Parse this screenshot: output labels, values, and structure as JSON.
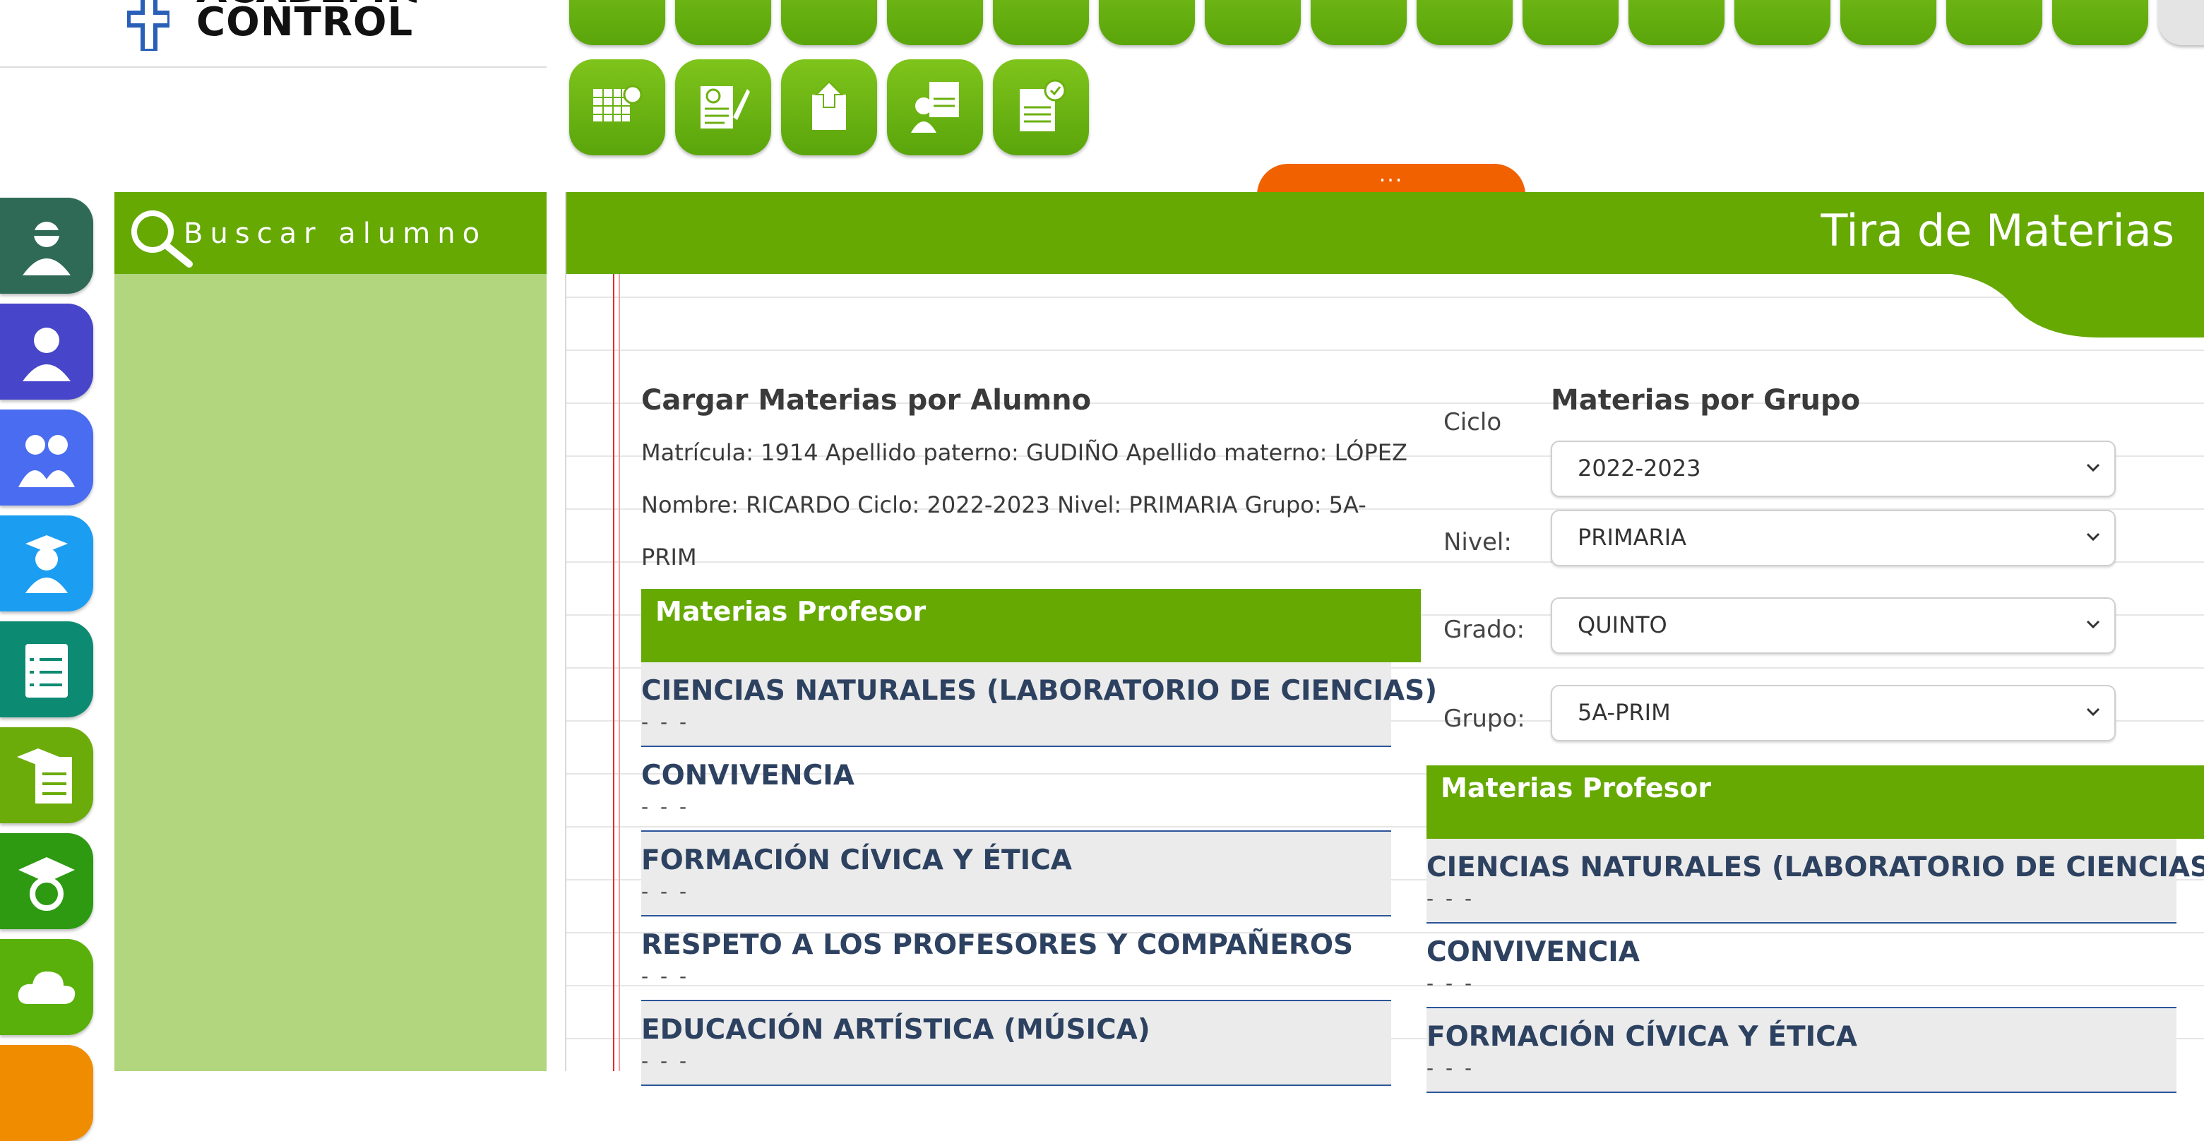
{
  "logo": {
    "brand": "CONTROL",
    "brand_top": "ACADEMIC"
  },
  "top_icons": [
    "checklist-icon",
    "chat-icon",
    "search-doc-icon",
    "student-search-icon",
    "sad-face-icon",
    "check-badge-icon",
    "percent-list-icon",
    "bar-chart-icon",
    "money-stack-icon",
    "task-list-icon",
    "graduate-icon",
    "bills-icon",
    "schedule-icon",
    "flow-lock-icon",
    "approve-list-icon",
    "calendar-grid-icon",
    "grade-edit-icon",
    "upload-doc-icon",
    "teacher-cert-icon",
    "certificate-icon"
  ],
  "expander": {
    "label": "..."
  },
  "side_icons": [
    {
      "name": "teacher-icon",
      "color": "#2e6a55"
    },
    {
      "name": "director-icon",
      "color": "#4745c9"
    },
    {
      "name": "parents-icon",
      "color": "#4a6cf0"
    },
    {
      "name": "student-icon",
      "color": "#1b9ef1"
    },
    {
      "name": "clipboard-icon",
      "color": "#0d8a72"
    },
    {
      "name": "courses-icon",
      "color": "#6cac0a"
    },
    {
      "name": "graduation-settings-icon",
      "color": "#2d9a12"
    },
    {
      "name": "cloud-icon",
      "color": "#5ab00a"
    },
    {
      "name": "extra-icon",
      "color": "#f08c00"
    }
  ],
  "search": {
    "label": "Buscar alumno"
  },
  "header": {
    "title": "Tira de Materias"
  },
  "student": {
    "heading": "Cargar Materias por Alumno",
    "line1": "Matrícula: 1914 Apellido paterno: GUDIÑO Apellido materno: LÓPEZ",
    "line2": "Nombre: RICARDO Ciclo: 2022-2023 Nivel: PRIMARIA Grupo: 5A-",
    "line3": "PRIM",
    "bar_label": "Materias Profesor",
    "subjects": [
      {
        "name": "CIENCIAS NATURALES (LABORATORIO DE CIENCIAS)",
        "dash": "- - -"
      },
      {
        "name": "CONVIVENCIA",
        "dash": "- - -"
      },
      {
        "name": "FORMACIÓN CÍVICA Y ÉTICA",
        "dash": "- - -"
      },
      {
        "name": "RESPETO A LOS PROFESORES Y COMPAÑEROS",
        "dash": "- - -"
      },
      {
        "name": "EDUCACIÓN ARTÍSTICA (MÚSICA)",
        "dash": "- - -"
      }
    ]
  },
  "group": {
    "heading": "Materias por Grupo",
    "ciclo_label": "Ciclo",
    "ciclo_value": "2022-2023",
    "nivel_label": "Nivel:",
    "nivel_value": "PRIMARIA",
    "grado_label": "Grado:",
    "grado_value": "QUINTO",
    "grupo_label": "Grupo:",
    "grupo_value": "5A-PRIM",
    "bar_label": "Materias Profesor",
    "subjects": [
      {
        "name": "CIENCIAS NATURALES (LABORATORIO DE CIENCIAS)",
        "dash": "- - -"
      },
      {
        "name": "CONVIVENCIA",
        "dash": "- - -"
      },
      {
        "name": "FORMACIÓN CÍVICA Y ÉTICA",
        "dash": "- - -"
      }
    ]
  }
}
